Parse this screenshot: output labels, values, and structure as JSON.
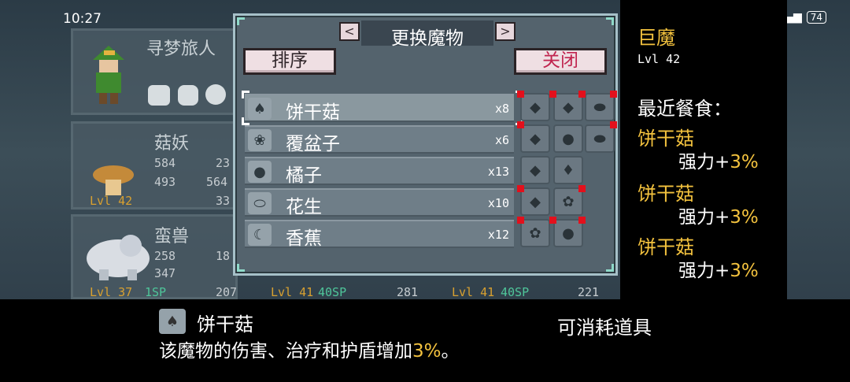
{
  "status": {
    "time": "10:27",
    "battery": "74"
  },
  "background_cards": {
    "top": {
      "name": "寻梦旅人"
    },
    "card1": {
      "name": "菇妖",
      "lvl": "Lvl 42",
      "atk": "584",
      "hp": "493",
      "v1": "23",
      "v2": "564",
      "v3": "33"
    },
    "card2": {
      "name": "蛮兽",
      "lvl": "Lvl 37",
      "sp": "1SP",
      "atk": "258",
      "hp": "347",
      "v1": "18",
      "v3": "207"
    },
    "card3": {
      "lvl": "Lvl 41",
      "sp": "40SP",
      "v": "281"
    },
    "card4": {
      "lvl": "Lvl 41",
      "sp": "40SP",
      "v": "221"
    }
  },
  "popup": {
    "title": "更换魔物",
    "prev": "<",
    "next": ">",
    "sort_label": "排序",
    "close_label": "关闭",
    "items": [
      {
        "name": "饼干菇",
        "count": "x8",
        "icon": "mushroom-icon"
      },
      {
        "name": "覆盆子",
        "count": "x6",
        "icon": "raspberry-icon"
      },
      {
        "name": "橘子",
        "count": "x13",
        "icon": "orange-icon"
      },
      {
        "name": "花生",
        "count": "x10",
        "icon": "peanut-icon"
      },
      {
        "name": "香蕉",
        "count": "x12",
        "icon": "banana-icon"
      }
    ]
  },
  "right_panel": {
    "monster_name": "巨魔",
    "lvl": "Lvl 42",
    "recent_title": "最近餐食：",
    "foods": [
      {
        "name": "饼干菇",
        "bonus_label": "强力+",
        "bonus_pct": "3%"
      },
      {
        "name": "饼干菇",
        "bonus_label": "强力+",
        "bonus_pct": "3%"
      },
      {
        "name": "饼干菇",
        "bonus_label": "强力+",
        "bonus_pct": "3%"
      }
    ]
  },
  "bottom": {
    "item_name": "饼干菇",
    "item_type": "可消耗道具",
    "desc_prefix": "该魔物的伤害、治疗和护盾增加",
    "desc_pct": "3%",
    "desc_suffix": "。"
  },
  "colors": {
    "accent_gold": "#f3c23e",
    "red_marker": "#e3101c",
    "close_text": "#c0254f"
  }
}
